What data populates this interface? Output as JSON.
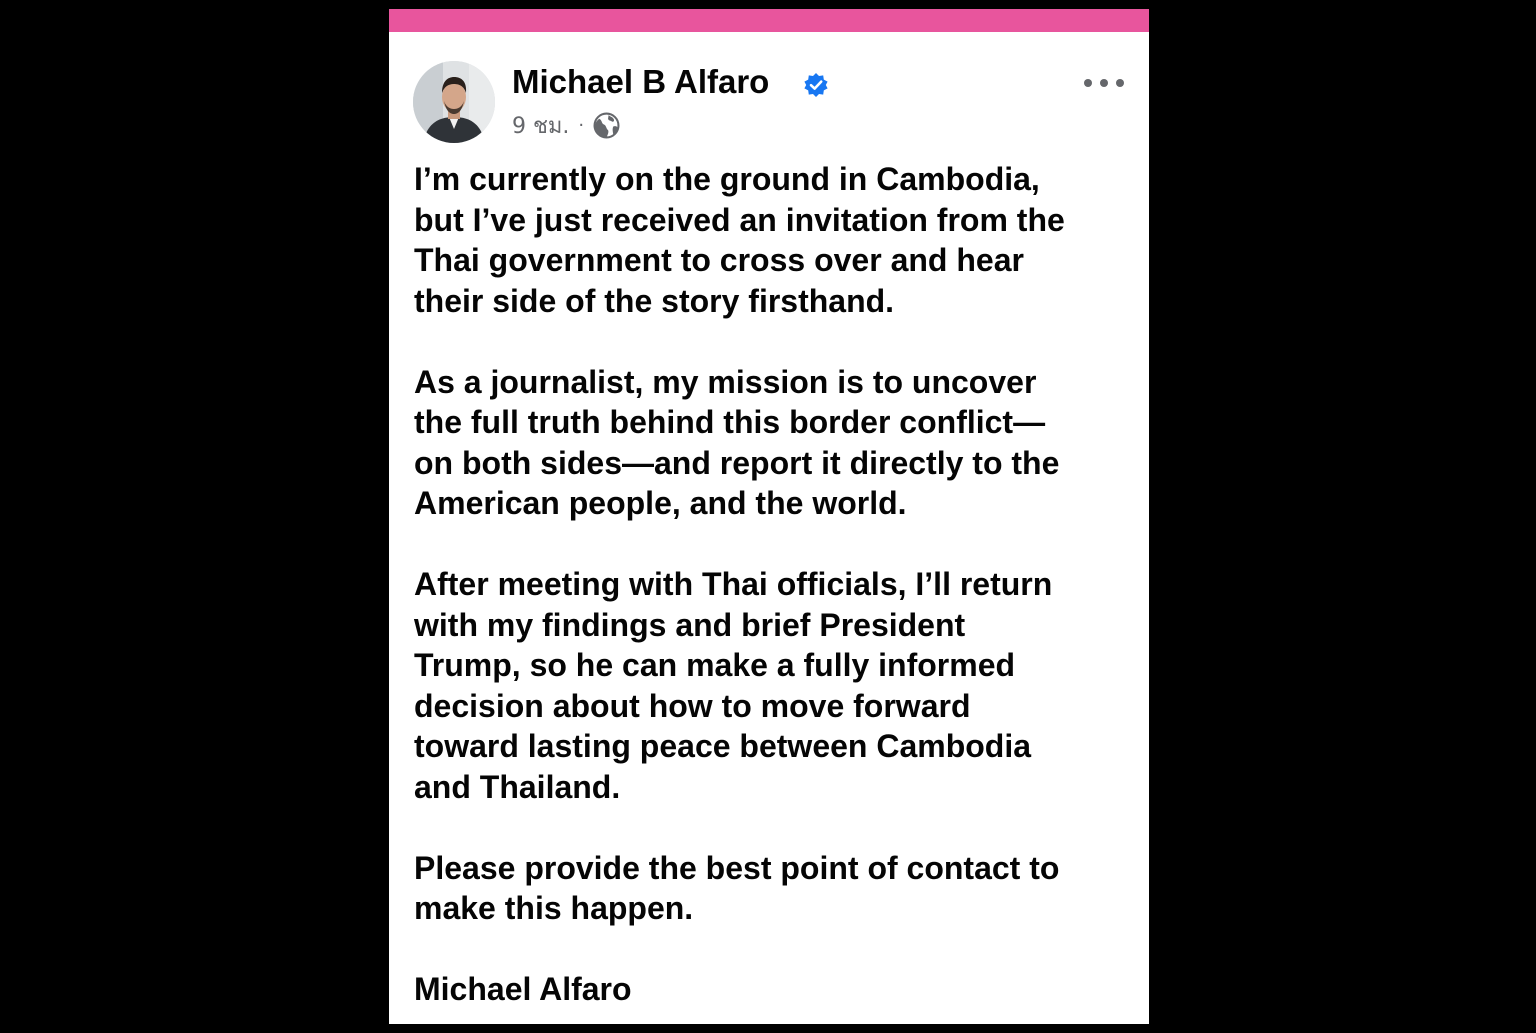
{
  "post": {
    "author": "Michael B Alfaro",
    "time": "9 ชม.",
    "separator": "·",
    "privacy_icon": "globe-icon",
    "verified_icon": "verified-badge-icon",
    "more_icon": "more-options-icon",
    "paragraphs": [
      "I’m currently on the ground in Cambodia,\nbut I’ve just received an invitation from the\nThai government to cross over and hear\ntheir side of the story firsthand.",
      "As a journalist, my mission is to uncover\nthe full truth behind this border conflict—\non both sides—and report it directly to the\nAmerican people, and the world.",
      "After meeting with Thai officials, I’ll return\nwith my findings and brief President\nTrump, so he can make a fully informed\ndecision about how to move forward\ntoward lasting peace between Cambodia\nand Thailand.",
      "Please provide the best point of contact to\nmake this happen.",
      "Michael Alfaro"
    ]
  },
  "colors": {
    "accent_bar": "#e8559d",
    "verified_blue": "#1877f2",
    "meta_gray": "#65676b",
    "text": "#050505"
  }
}
